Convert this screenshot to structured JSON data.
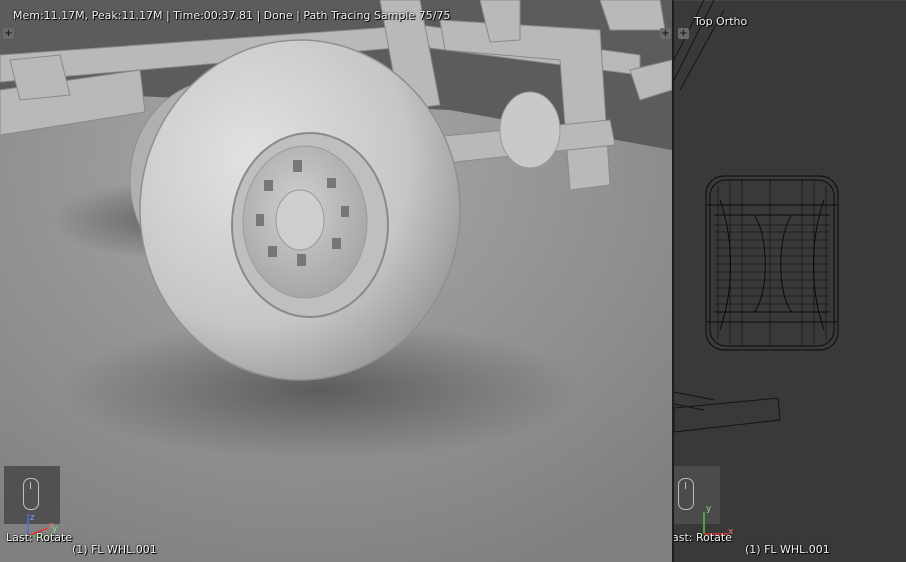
{
  "render_viewport": {
    "status_text": "Mem:11.17M, Peak:11.17M | Time:00:37.81 | Done | Path Tracing Sample 75/75",
    "last_operator": "Last: Rotate",
    "object_label": "(1) FL WHL.001",
    "axis_labels": {
      "x": "x",
      "y": "y",
      "z": "z"
    }
  },
  "ortho_viewport": {
    "view_name": "Top Ortho",
    "last_operator": "ast: Rotate",
    "object_label": "(1) FL WHL.001",
    "axis_labels": {
      "x": "x",
      "y": "y"
    }
  },
  "colors": {
    "render_background": "#8c8c8c",
    "ortho_background": "#393939",
    "wire_color": "#0a0a0a",
    "axis_x": "#e23a3a",
    "axis_y": "#4fc24f",
    "axis_z": "#4d6fe0"
  }
}
